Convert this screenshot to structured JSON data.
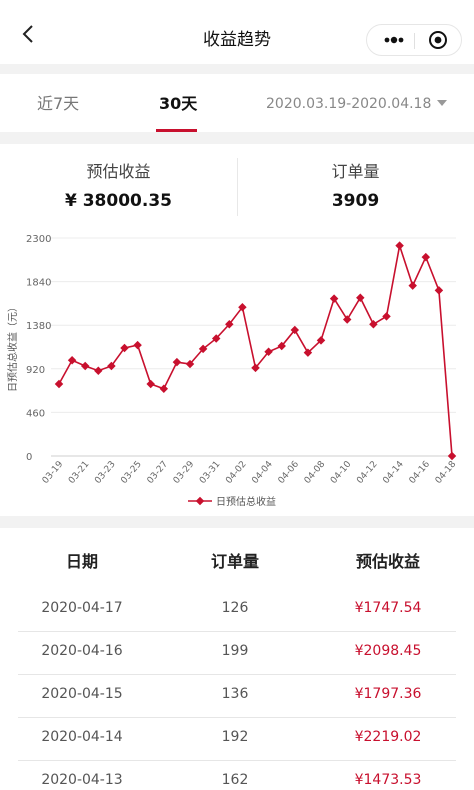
{
  "navbar": {
    "title": "收益趋势"
  },
  "tabs": {
    "items": [
      {
        "label": "近7天",
        "active": false
      },
      {
        "label": "30天",
        "active": true
      }
    ],
    "date_range": "2020.03.19-2020.04.18"
  },
  "summary": {
    "est_income_label": "预估收益",
    "est_income_value": "¥ 38000.35",
    "orders_label": "订单量",
    "orders_value": "3909"
  },
  "chart_data": {
    "type": "line",
    "ylabel": "日预估总收益（元）",
    "yticks": [
      "2300",
      "1840",
      "1380",
      "920",
      "460",
      "0"
    ],
    "ylim": [
      0,
      2300
    ],
    "grid": true,
    "legend": "bottom",
    "color": "#c8102e",
    "x_tick_labels": [
      "03-19",
      "03-21",
      "03-23",
      "03-25",
      "03-27",
      "03-29",
      "03-31",
      "04-02",
      "04-04",
      "04-06",
      "04-08",
      "04-10",
      "04-12",
      "04-14",
      "04-16",
      "04-18"
    ],
    "series": [
      {
        "name": "日预估总收益",
        "x": [
          "03-19",
          "03-20",
          "03-21",
          "03-22",
          "03-23",
          "03-24",
          "03-25",
          "03-26",
          "03-27",
          "03-28",
          "03-29",
          "03-30",
          "03-31",
          "04-01",
          "04-02",
          "04-03",
          "04-04",
          "04-05",
          "04-06",
          "04-07",
          "04-08",
          "04-09",
          "04-10",
          "04-11",
          "04-12",
          "04-13",
          "04-14",
          "04-15",
          "04-16",
          "04-17",
          "04-18"
        ],
        "values": [
          760,
          1010,
          950,
          900,
          950,
          1140,
          1170,
          760,
          710,
          990,
          970,
          1130,
          1240,
          1390,
          1570,
          930,
          1100,
          1160,
          1330,
          1090,
          1220,
          1660,
          1440,
          1670,
          1390,
          1473.53,
          2219.02,
          1797.36,
          2098.45,
          1747.54,
          0
        ]
      }
    ]
  },
  "table": {
    "headers": [
      "日期",
      "订单量",
      "预估收益"
    ],
    "rows": [
      {
        "date": "2020-04-17",
        "orders": "126",
        "est": "¥1747.54"
      },
      {
        "date": "2020-04-16",
        "orders": "199",
        "est": "¥2098.45"
      },
      {
        "date": "2020-04-15",
        "orders": "136",
        "est": "¥1797.36"
      },
      {
        "date": "2020-04-14",
        "orders": "192",
        "est": "¥2219.02"
      },
      {
        "date": "2020-04-13",
        "orders": "162",
        "est": "¥1473.53"
      }
    ]
  }
}
